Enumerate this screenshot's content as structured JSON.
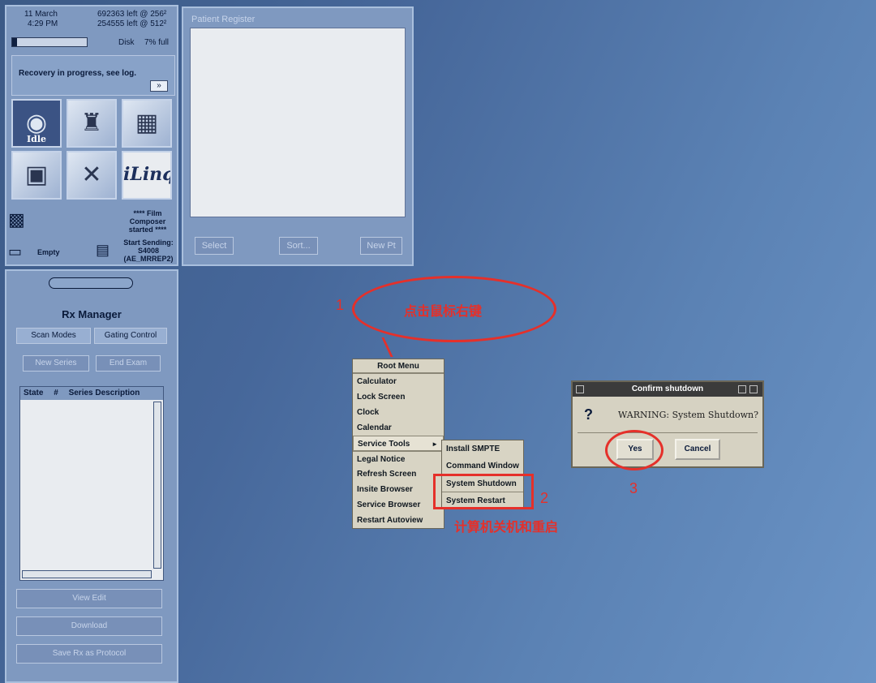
{
  "status": {
    "date": "11 March",
    "time": "4:29 PM",
    "left_256": "692363 left @ 256²",
    "left_512": "254555 left @ 512²",
    "disk_label": "Disk",
    "disk_full": "7% full",
    "disk_fraction": 0.07,
    "recovery_message": "Recovery in progress, see log.",
    "recovery_more": "»",
    "scanner_state": "Idle",
    "iling_label": "iLinq",
    "film_status": "**** Film Composer started ****",
    "printer_status": "Empty",
    "send_status": "Start Sending: S4008 (AE_MRREP2)"
  },
  "icons": [
    "scanner-icon",
    "patient-icon",
    "viewer-icon",
    "workstation-icon",
    "tools-icon",
    "iling-icon",
    "film-icon",
    "printer-icon",
    "network-icon"
  ],
  "patient": {
    "title": "Patient Register",
    "select_label": "Select",
    "sort_label": "Sort...",
    "new_pt_label": "New Pt"
  },
  "rx": {
    "title": "Rx Manager",
    "scan_modes": "Scan Modes",
    "gating_control": "Gating Control",
    "new_series": "New Series",
    "end_exam": "End Exam",
    "col_state": "State",
    "col_num": "#",
    "col_desc": "Series Description",
    "view_edit": "View Edit",
    "download": "Download",
    "save_protocol": "Save Rx as Protocol"
  },
  "root_menu": {
    "title": "Root Menu",
    "items": [
      "Calculator",
      "Lock Screen",
      "Clock",
      "Calendar"
    ],
    "service_tools": "Service Tools",
    "items2": [
      "Legal Notice",
      "Refresh Screen",
      "Insite Browser",
      "Service Browser",
      "Restart Autoview"
    ]
  },
  "service_menu": {
    "items": [
      "Install SMPTE",
      "Command Window",
      "System Shutdown",
      "System Restart"
    ]
  },
  "dialog": {
    "title": "Confirm shutdown",
    "warning": "WARNING: System Shutdown?",
    "yes": "Yes",
    "cancel": "Cancel"
  },
  "annotations": {
    "step1": "1",
    "step1_text": "点击鼠标右键",
    "step2": "2",
    "step2_text": "计算机关机和重启",
    "step3": "3",
    "color": "#e5302a"
  }
}
